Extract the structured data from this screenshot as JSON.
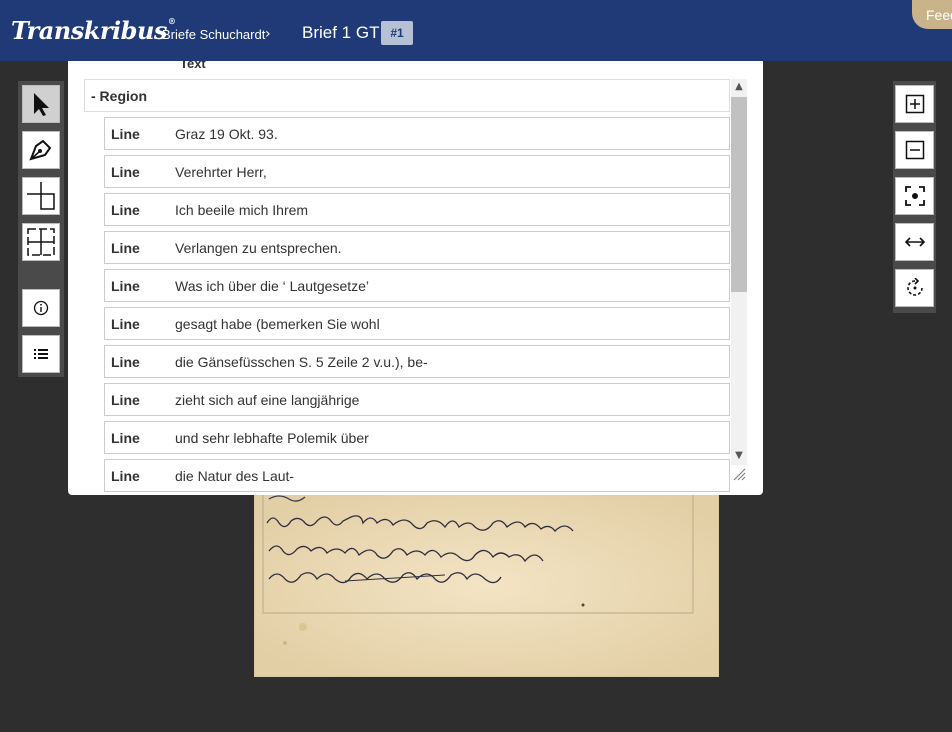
{
  "header": {
    "logo": "Transkribus",
    "collection": "Briefe Schuchardt",
    "document": "Brief 1 GT",
    "page_badge": "#1",
    "feedback_label": "Feedback"
  },
  "colors": {
    "header_bg": "#1f3a77",
    "feedback_bg": "#c9b38a",
    "canvas_bg": "#2e2e2e"
  },
  "left_toolbar": {
    "icons": [
      "pointer-icon",
      "pen-icon",
      "split-line-icon",
      "split-region-icon",
      "info-icon",
      "list-icon"
    ]
  },
  "right_toolbar": {
    "icons": [
      "zoom-in-icon",
      "zoom-out-icon",
      "fit-screen-icon",
      "fit-width-icon",
      "rotate-icon"
    ]
  },
  "panel": {
    "header_label": "Text",
    "region_label": "- Region",
    "lines": [
      {
        "type": "Line",
        "text": "Graz 19 Okt. 93."
      },
      {
        "type": "Line",
        "text": "Verehrter Herr,"
      },
      {
        "type": "Line",
        "text": "Ich beeile mich Ihrem"
      },
      {
        "type": "Line",
        "text": "Verlangen zu entsprechen."
      },
      {
        "type": "Line",
        "text": "Was ich über die ‘ Lautgesetze’"
      },
      {
        "type": "Line",
        "text": "gesagt habe (bemerken Sie wohl"
      },
      {
        "type": "Line",
        "text": "die Gänsefüsschen S. 5 Zeile 2 v.u.), be-"
      },
      {
        "type": "Line",
        "text": "zieht sich auf eine langjährige"
      },
      {
        "type": "Line",
        "text": "und sehr lebhafte Polemik über"
      },
      {
        "type": "Line",
        "text": "die Natur des Laut-"
      }
    ]
  }
}
